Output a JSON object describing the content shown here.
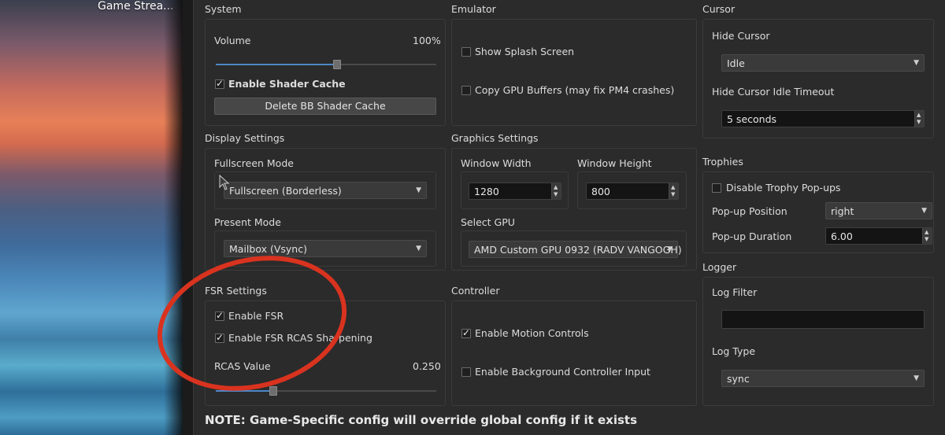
{
  "desktop": {
    "window_title": "Game Strea..."
  },
  "system": {
    "title": "System",
    "volume_label": "Volume",
    "volume_value": "100%",
    "volume_level": 0.55,
    "shader_cache_label": "Enable Shader Cache",
    "shader_cache_checked": true,
    "delete_cache_label": "Delete BB Shader Cache"
  },
  "emulator": {
    "title": "Emulator",
    "splash_label": "Show Splash Screen",
    "splash_checked": false,
    "copy_gpu_label": "Copy GPU Buffers (may fix PM4 crashes)",
    "copy_gpu_checked": false
  },
  "cursor": {
    "title": "Cursor",
    "hide_label": "Hide Cursor",
    "hide_value": "Idle",
    "timeout_label": "Hide Cursor Idle Timeout",
    "timeout_value": "5 seconds"
  },
  "display": {
    "title": "Display Settings",
    "fullscreen_label": "Fullscreen Mode",
    "fullscreen_value": "Fullscreen (Borderless)",
    "present_label": "Present Mode",
    "present_value": "Mailbox (Vsync)"
  },
  "graphics": {
    "title": "Graphics Settings",
    "width_label": "Window Width",
    "width_value": "1280",
    "height_label": "Window Height",
    "height_value": "800",
    "gpu_label": "Select GPU",
    "gpu_value": "AMD Custom GPU 0932 (RADV VANGOGH)"
  },
  "trophies": {
    "title": "Trophies",
    "disable_label": "Disable Trophy Pop-ups",
    "disable_checked": false,
    "position_label": "Pop-up Position",
    "position_value": "right",
    "duration_label": "Pop-up Duration",
    "duration_value": "6.00"
  },
  "fsr": {
    "title": "FSR Settings",
    "enable_label": "Enable FSR",
    "enable_checked": true,
    "rcas_label": "Enable FSR RCAS Sharpening",
    "rcas_checked": true,
    "rcas_value_label": "RCAS Value",
    "rcas_value": "0.250",
    "rcas_level": 0.25
  },
  "controller": {
    "title": "Controller",
    "motion_label": "Enable Motion Controls",
    "motion_checked": true,
    "background_label": "Enable Background Controller Input",
    "background_checked": false
  },
  "logger": {
    "title": "Logger",
    "filter_label": "Log Filter",
    "filter_value": "",
    "type_label": "Log Type",
    "type_value": "sync"
  },
  "note": "NOTE: Game-Specific config will override global config if it exists",
  "colors": {
    "accent": "#4e86c6",
    "annotation": "#d9331f",
    "panel": "#2b2b2b"
  }
}
